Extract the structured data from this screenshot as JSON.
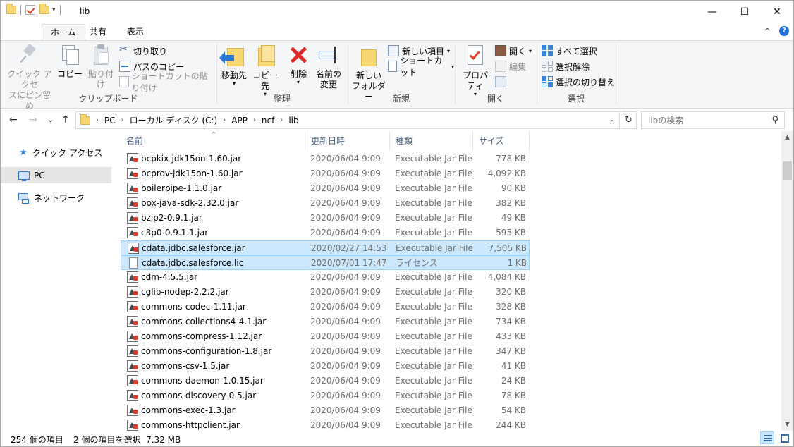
{
  "window": {
    "title": "lib",
    "minimize": "—",
    "maximize": "☐",
    "close": "✕"
  },
  "ribbon_tabs": [
    {
      "label": "ホーム"
    },
    {
      "label": "共有"
    },
    {
      "label": "表示"
    }
  ],
  "ribbon_right": {
    "collapse": "^",
    "help": "?"
  },
  "clipboard": {
    "group_label": "クリップボード",
    "pin_label_1": "クイック アクセ",
    "pin_label_2": "スにピン留め",
    "copy_label": "コピー",
    "paste_label": "貼り付け",
    "cut_label": "切り取り",
    "copy_path_label": "パスのコピー",
    "paste_shortcut_label": "ショートカットの貼り付け"
  },
  "organize": {
    "group_label": "整理",
    "move_label": "移動先",
    "copyto_label": "コピー先",
    "delete_label": "削除",
    "rename_label_1": "名前の",
    "rename_label_2": "変更"
  },
  "new": {
    "group_label": "新規",
    "newfolder_label_1": "新しい",
    "newfolder_label_2": "フォルダー",
    "newitem_label": "新しい項目",
    "easyaccess_label": "ショートカット"
  },
  "open": {
    "group_label": "開く",
    "props_label": "プロパティ",
    "open_label": "開く",
    "edit_label": "編集"
  },
  "select": {
    "group_label": "選択",
    "selall_label": "すべて選択",
    "selnone_label": "選択解除",
    "invert_label": "選択の切り替え"
  },
  "address": {
    "back": "←",
    "forward": "→",
    "recent": "⌄",
    "up": "↑",
    "crumbs": [
      "PC",
      "ローカル ディスク (C:)",
      "APP",
      "ncf",
      "lib"
    ],
    "chev": "›",
    "dropdown": "⌄",
    "refresh": "↻"
  },
  "search": {
    "placeholder": "libの検索",
    "icon": "⚲"
  },
  "navpane": {
    "quick_access": "クイック アクセス",
    "pc": "PC",
    "network": "ネットワーク"
  },
  "columns": {
    "name": "名前",
    "date": "更新日時",
    "type": "種類",
    "size": "サイズ",
    "sort": "^"
  },
  "files": [
    {
      "name": "bcpkix-jdk15on-1.60.jar",
      "date": "2020/06/04 9:09",
      "type": "Executable Jar File",
      "size": "778 KB",
      "icon": "jar-icon",
      "selected": false
    },
    {
      "name": "bcprov-jdk15on-1.60.jar",
      "date": "2020/06/04 9:09",
      "type": "Executable Jar File",
      "size": "4,092 KB",
      "icon": "jar-icon",
      "selected": false
    },
    {
      "name": "boilerpipe-1.1.0.jar",
      "date": "2020/06/04 9:09",
      "type": "Executable Jar File",
      "size": "90 KB",
      "icon": "jar-icon",
      "selected": false
    },
    {
      "name": "box-java-sdk-2.32.0.jar",
      "date": "2020/06/04 9:09",
      "type": "Executable Jar File",
      "size": "382 KB",
      "icon": "jar-icon",
      "selected": false
    },
    {
      "name": "bzip2-0.9.1.jar",
      "date": "2020/06/04 9:09",
      "type": "Executable Jar File",
      "size": "49 KB",
      "icon": "jar-icon",
      "selected": false
    },
    {
      "name": "c3p0-0.9.1.1.jar",
      "date": "2020/06/04 9:09",
      "type": "Executable Jar File",
      "size": "595 KB",
      "icon": "jar-icon",
      "selected": false
    },
    {
      "name": "cdata.jdbc.salesforce.jar",
      "date": "2020/02/27 14:53",
      "type": "Executable Jar File",
      "size": "7,505 KB",
      "icon": "jar-icon",
      "selected": true
    },
    {
      "name": "cdata.jdbc.salesforce.lic",
      "date": "2020/07/01 17:47",
      "type": "ライセンス",
      "size": "1 KB",
      "icon": "document-icon",
      "selected": true
    },
    {
      "name": "cdm-4.5.5.jar",
      "date": "2020/06/04 9:09",
      "type": "Executable Jar File",
      "size": "4,084 KB",
      "icon": "jar-icon",
      "selected": false
    },
    {
      "name": "cglib-nodep-2.2.2.jar",
      "date": "2020/06/04 9:09",
      "type": "Executable Jar File",
      "size": "320 KB",
      "icon": "jar-icon",
      "selected": false
    },
    {
      "name": "commons-codec-1.11.jar",
      "date": "2020/06/04 9:09",
      "type": "Executable Jar File",
      "size": "328 KB",
      "icon": "jar-icon",
      "selected": false
    },
    {
      "name": "commons-collections4-4.1.jar",
      "date": "2020/06/04 9:09",
      "type": "Executable Jar File",
      "size": "734 KB",
      "icon": "jar-icon",
      "selected": false
    },
    {
      "name": "commons-compress-1.12.jar",
      "date": "2020/06/04 9:09",
      "type": "Executable Jar File",
      "size": "433 KB",
      "icon": "jar-icon",
      "selected": false
    },
    {
      "name": "commons-configuration-1.8.jar",
      "date": "2020/06/04 9:09",
      "type": "Executable Jar File",
      "size": "347 KB",
      "icon": "jar-icon",
      "selected": false
    },
    {
      "name": "commons-csv-1.5.jar",
      "date": "2020/06/04 9:09",
      "type": "Executable Jar File",
      "size": "41 KB",
      "icon": "jar-icon",
      "selected": false
    },
    {
      "name": "commons-daemon-1.0.15.jar",
      "date": "2020/06/04 9:09",
      "type": "Executable Jar File",
      "size": "24 KB",
      "icon": "jar-icon",
      "selected": false
    },
    {
      "name": "commons-discovery-0.5.jar",
      "date": "2020/06/04 9:09",
      "type": "Executable Jar File",
      "size": "78 KB",
      "icon": "jar-icon",
      "selected": false
    },
    {
      "name": "commons-exec-1.3.jar",
      "date": "2020/06/04 9:09",
      "type": "Executable Jar File",
      "size": "54 KB",
      "icon": "jar-icon",
      "selected": false
    },
    {
      "name": "commons-httpclient.jar",
      "date": "2020/06/04 9:09",
      "type": "Executable Jar File",
      "size": "244 KB",
      "icon": "jar-icon",
      "selected": false
    }
  ],
  "status": {
    "count": "254 個の項目",
    "selection": "2 個の項目を選択  7.32 MB"
  },
  "colors": {
    "selection_bg": "#cce8ff",
    "selection_border": "#99d1ff",
    "accent": "#2b78d8"
  }
}
